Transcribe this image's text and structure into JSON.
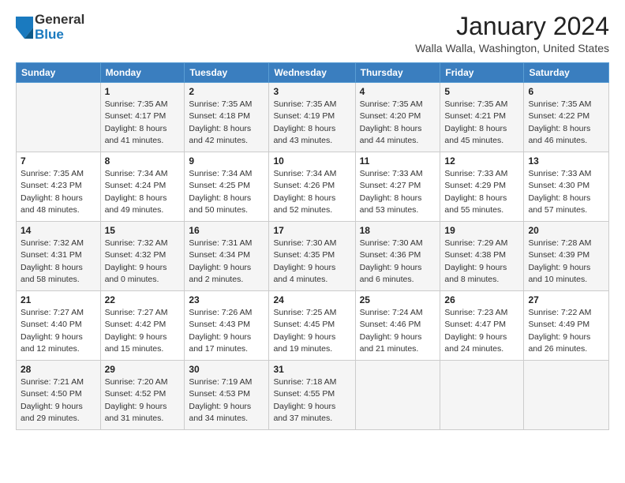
{
  "header": {
    "logo": {
      "general": "General",
      "blue": "Blue"
    },
    "title": "January 2024",
    "location": "Walla Walla, Washington, United States"
  },
  "weekdays": [
    "Sunday",
    "Monday",
    "Tuesday",
    "Wednesday",
    "Thursday",
    "Friday",
    "Saturday"
  ],
  "weeks": [
    [
      {
        "day": "",
        "sunrise": "",
        "sunset": "",
        "daylight": ""
      },
      {
        "day": "1",
        "sunrise": "Sunrise: 7:35 AM",
        "sunset": "Sunset: 4:17 PM",
        "daylight": "Daylight: 8 hours and 41 minutes."
      },
      {
        "day": "2",
        "sunrise": "Sunrise: 7:35 AM",
        "sunset": "Sunset: 4:18 PM",
        "daylight": "Daylight: 8 hours and 42 minutes."
      },
      {
        "day": "3",
        "sunrise": "Sunrise: 7:35 AM",
        "sunset": "Sunset: 4:19 PM",
        "daylight": "Daylight: 8 hours and 43 minutes."
      },
      {
        "day": "4",
        "sunrise": "Sunrise: 7:35 AM",
        "sunset": "Sunset: 4:20 PM",
        "daylight": "Daylight: 8 hours and 44 minutes."
      },
      {
        "day": "5",
        "sunrise": "Sunrise: 7:35 AM",
        "sunset": "Sunset: 4:21 PM",
        "daylight": "Daylight: 8 hours and 45 minutes."
      },
      {
        "day": "6",
        "sunrise": "Sunrise: 7:35 AM",
        "sunset": "Sunset: 4:22 PM",
        "daylight": "Daylight: 8 hours and 46 minutes."
      }
    ],
    [
      {
        "day": "7",
        "sunrise": "Sunrise: 7:35 AM",
        "sunset": "Sunset: 4:23 PM",
        "daylight": "Daylight: 8 hours and 48 minutes."
      },
      {
        "day": "8",
        "sunrise": "Sunrise: 7:34 AM",
        "sunset": "Sunset: 4:24 PM",
        "daylight": "Daylight: 8 hours and 49 minutes."
      },
      {
        "day": "9",
        "sunrise": "Sunrise: 7:34 AM",
        "sunset": "Sunset: 4:25 PM",
        "daylight": "Daylight: 8 hours and 50 minutes."
      },
      {
        "day": "10",
        "sunrise": "Sunrise: 7:34 AM",
        "sunset": "Sunset: 4:26 PM",
        "daylight": "Daylight: 8 hours and 52 minutes."
      },
      {
        "day": "11",
        "sunrise": "Sunrise: 7:33 AM",
        "sunset": "Sunset: 4:27 PM",
        "daylight": "Daylight: 8 hours and 53 minutes."
      },
      {
        "day": "12",
        "sunrise": "Sunrise: 7:33 AM",
        "sunset": "Sunset: 4:29 PM",
        "daylight": "Daylight: 8 hours and 55 minutes."
      },
      {
        "day": "13",
        "sunrise": "Sunrise: 7:33 AM",
        "sunset": "Sunset: 4:30 PM",
        "daylight": "Daylight: 8 hours and 57 minutes."
      }
    ],
    [
      {
        "day": "14",
        "sunrise": "Sunrise: 7:32 AM",
        "sunset": "Sunset: 4:31 PM",
        "daylight": "Daylight: 8 hours and 58 minutes."
      },
      {
        "day": "15",
        "sunrise": "Sunrise: 7:32 AM",
        "sunset": "Sunset: 4:32 PM",
        "daylight": "Daylight: 9 hours and 0 minutes."
      },
      {
        "day": "16",
        "sunrise": "Sunrise: 7:31 AM",
        "sunset": "Sunset: 4:34 PM",
        "daylight": "Daylight: 9 hours and 2 minutes."
      },
      {
        "day": "17",
        "sunrise": "Sunrise: 7:30 AM",
        "sunset": "Sunset: 4:35 PM",
        "daylight": "Daylight: 9 hours and 4 minutes."
      },
      {
        "day": "18",
        "sunrise": "Sunrise: 7:30 AM",
        "sunset": "Sunset: 4:36 PM",
        "daylight": "Daylight: 9 hours and 6 minutes."
      },
      {
        "day": "19",
        "sunrise": "Sunrise: 7:29 AM",
        "sunset": "Sunset: 4:38 PM",
        "daylight": "Daylight: 9 hours and 8 minutes."
      },
      {
        "day": "20",
        "sunrise": "Sunrise: 7:28 AM",
        "sunset": "Sunset: 4:39 PM",
        "daylight": "Daylight: 9 hours and 10 minutes."
      }
    ],
    [
      {
        "day": "21",
        "sunrise": "Sunrise: 7:27 AM",
        "sunset": "Sunset: 4:40 PM",
        "daylight": "Daylight: 9 hours and 12 minutes."
      },
      {
        "day": "22",
        "sunrise": "Sunrise: 7:27 AM",
        "sunset": "Sunset: 4:42 PM",
        "daylight": "Daylight: 9 hours and 15 minutes."
      },
      {
        "day": "23",
        "sunrise": "Sunrise: 7:26 AM",
        "sunset": "Sunset: 4:43 PM",
        "daylight": "Daylight: 9 hours and 17 minutes."
      },
      {
        "day": "24",
        "sunrise": "Sunrise: 7:25 AM",
        "sunset": "Sunset: 4:45 PM",
        "daylight": "Daylight: 9 hours and 19 minutes."
      },
      {
        "day": "25",
        "sunrise": "Sunrise: 7:24 AM",
        "sunset": "Sunset: 4:46 PM",
        "daylight": "Daylight: 9 hours and 21 minutes."
      },
      {
        "day": "26",
        "sunrise": "Sunrise: 7:23 AM",
        "sunset": "Sunset: 4:47 PM",
        "daylight": "Daylight: 9 hours and 24 minutes."
      },
      {
        "day": "27",
        "sunrise": "Sunrise: 7:22 AM",
        "sunset": "Sunset: 4:49 PM",
        "daylight": "Daylight: 9 hours and 26 minutes."
      }
    ],
    [
      {
        "day": "28",
        "sunrise": "Sunrise: 7:21 AM",
        "sunset": "Sunset: 4:50 PM",
        "daylight": "Daylight: 9 hours and 29 minutes."
      },
      {
        "day": "29",
        "sunrise": "Sunrise: 7:20 AM",
        "sunset": "Sunset: 4:52 PM",
        "daylight": "Daylight: 9 hours and 31 minutes."
      },
      {
        "day": "30",
        "sunrise": "Sunrise: 7:19 AM",
        "sunset": "Sunset: 4:53 PM",
        "daylight": "Daylight: 9 hours and 34 minutes."
      },
      {
        "day": "31",
        "sunrise": "Sunrise: 7:18 AM",
        "sunset": "Sunset: 4:55 PM",
        "daylight": "Daylight: 9 hours and 37 minutes."
      },
      {
        "day": "",
        "sunrise": "",
        "sunset": "",
        "daylight": ""
      },
      {
        "day": "",
        "sunrise": "",
        "sunset": "",
        "daylight": ""
      },
      {
        "day": "",
        "sunrise": "",
        "sunset": "",
        "daylight": ""
      }
    ]
  ]
}
